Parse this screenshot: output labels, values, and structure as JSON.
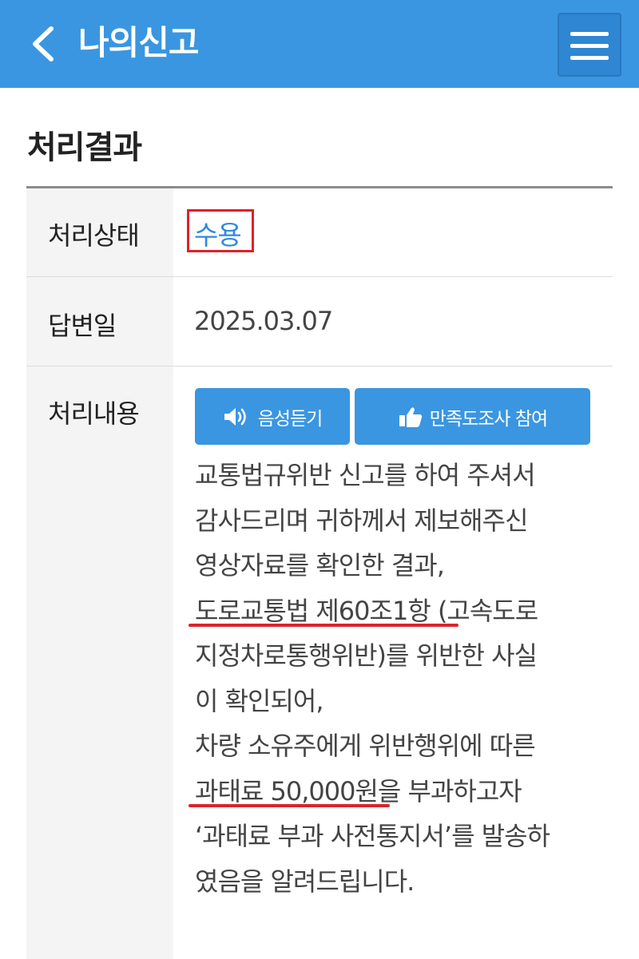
{
  "header": {
    "title": "나의신고",
    "back_icon": "chevron-left-icon",
    "menu_icon": "hamburger-menu-icon",
    "background_color": "#3a96e0"
  },
  "section": {
    "title": "처리결과"
  },
  "table": {
    "status_label": "처리상태",
    "status_value": "수용",
    "answer_date_label": "답변일",
    "answer_date_value": "2025.03.07",
    "content_label": "처리내용"
  },
  "buttons": {
    "voice_label": "음성듣기",
    "voice_icon": "speaker-icon",
    "survey_label": "만족도조사 참여",
    "survey_icon": "thumbs-up-icon"
  },
  "content_lines": [
    "교통법규위반 신고를 하여 주셔서",
    "감사드리며 귀하께서 제보해주신",
    "영상자료를 확인한 결과,",
    "도로교통법 제60조1항 (고속도로",
    "지정차로통행위반)를 위반한 사실",
    "이 확인되어,",
    "차량 소유주에게 위반행위에 따른",
    "과태료 50,000원을 부과하고자",
    "‘과태료 부과 사전통지서’를 발송하",
    "였음을 알려드립니다."
  ],
  "colors": {
    "accent": "#3a96e0",
    "status_text": "#2f8ae0",
    "highlight_red": "#d9252e"
  }
}
